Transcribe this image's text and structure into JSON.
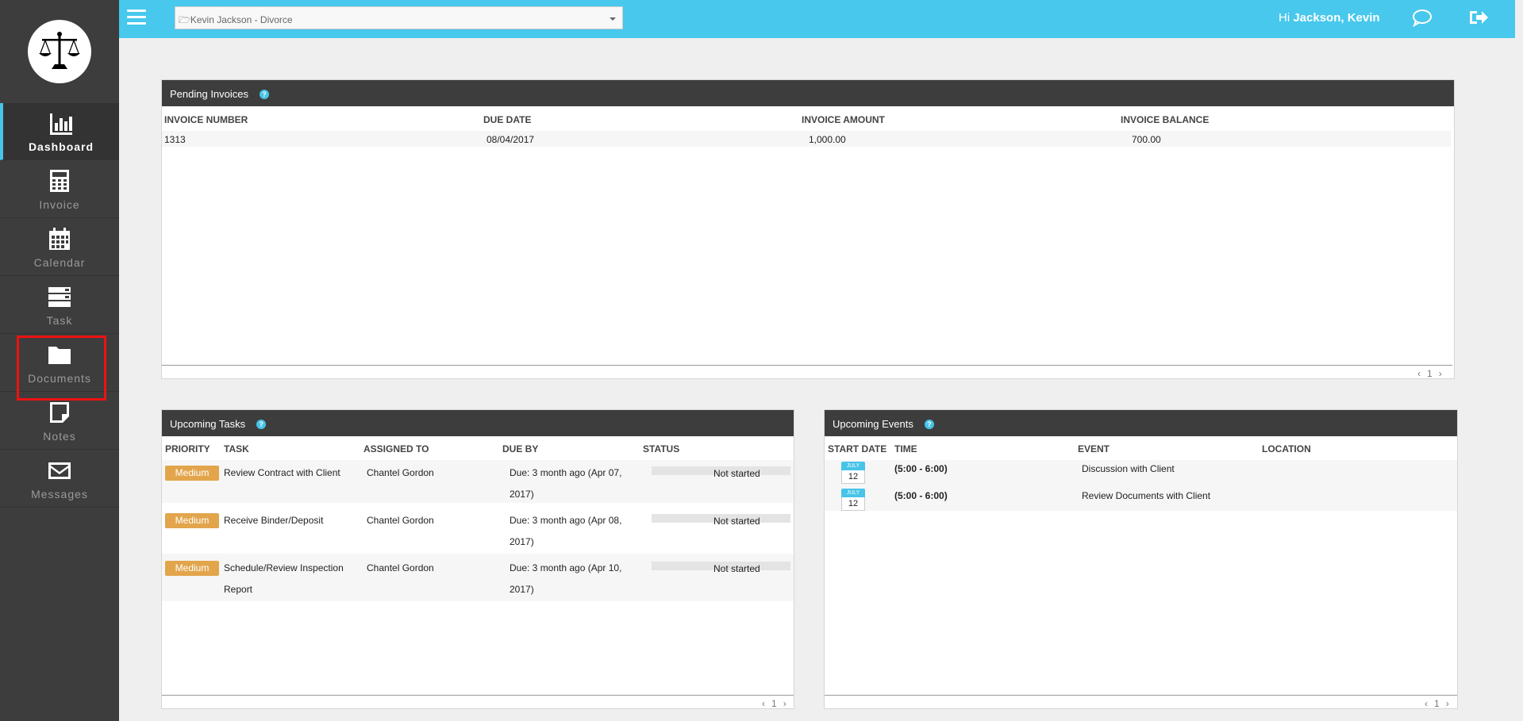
{
  "colors": {
    "accent": "#47c8ec",
    "sidebar": "#3d3d3d",
    "badge": "#e2a54b",
    "highlight": "#e11111"
  },
  "sidebar": {
    "logo_icon": "scales-of-justice-icon",
    "items": [
      {
        "label": "Dashboard",
        "icon": "bar-chart-icon"
      },
      {
        "label": "Invoice",
        "icon": "calculator-icon"
      },
      {
        "label": "Calendar",
        "icon": "calendar-icon"
      },
      {
        "label": "Task",
        "icon": "tasks-icon"
      },
      {
        "label": "Documents",
        "icon": "folder-icon"
      },
      {
        "label": "Notes",
        "icon": "sticky-note-icon"
      },
      {
        "label": "Messages",
        "icon": "envelope-icon"
      }
    ]
  },
  "header": {
    "case_selected": "🗁Kevin Jackson - Divorce",
    "greeting_prefix": "Hi ",
    "user_name": "Jackson, Kevin"
  },
  "invoices": {
    "title": "Pending Invoices",
    "help": "?",
    "columns": [
      "INVOICE NUMBER",
      "DUE DATE",
      "INVOICE AMOUNT",
      "INVOICE BALANCE"
    ],
    "rows": [
      {
        "number": "1313",
        "due": "08/04/2017",
        "amount": "1,000.00",
        "balance": "700.00"
      }
    ],
    "pager": {
      "prev": "‹",
      "page": "1",
      "next": "›"
    }
  },
  "tasks": {
    "title": "Upcoming Tasks",
    "help": "?",
    "columns": [
      "PRIORITY",
      "TASK",
      "ASSIGNED TO",
      "DUE BY",
      "STATUS"
    ],
    "rows": [
      {
        "priority": "Medium",
        "task_1": "Review Contract with Client",
        "task_2": "",
        "assigned": "Chantel Gordon",
        "due_1": "Due: 3 month ago (Apr 07,",
        "due_2": "2017)",
        "status": "Not started"
      },
      {
        "priority": "Medium",
        "task_1": "Receive Binder/Deposit",
        "task_2": "",
        "assigned": "Chantel Gordon",
        "due_1": "Due: 3 month ago (Apr 08,",
        "due_2": "2017)",
        "status": "Not started"
      },
      {
        "priority": "Medium",
        "task_1": "Schedule/Review Inspection",
        "task_2": "Report",
        "assigned": "Chantel Gordon",
        "due_1": "Due: 3 month ago (Apr 10,",
        "due_2": "2017)",
        "status": "Not started"
      }
    ],
    "pager": {
      "prev": "‹",
      "page": "1",
      "next": "›"
    }
  },
  "events": {
    "title": "Upcoming Events",
    "help": "?",
    "columns": [
      "START DATE",
      "TIME",
      "EVENT",
      "LOCATION"
    ],
    "rows": [
      {
        "month": "JULY",
        "day": "12",
        "time": "(5:00 - 6:00)",
        "event": "Discussion with Client",
        "location": ""
      },
      {
        "month": "JULY",
        "day": "12",
        "time": "(5:00 - 6:00)",
        "event": "Review Documents with Client",
        "location": ""
      }
    ],
    "pager": {
      "prev": "‹",
      "page": "1",
      "next": "›"
    }
  }
}
